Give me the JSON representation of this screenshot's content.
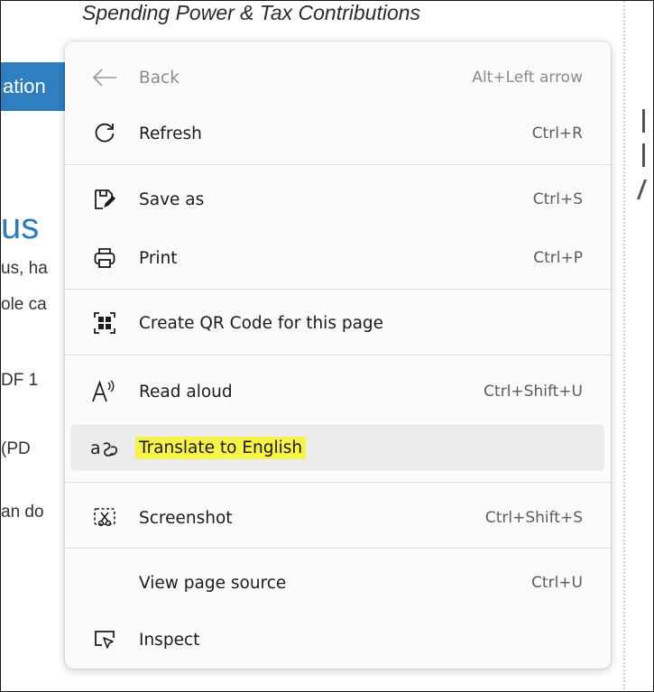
{
  "background": {
    "heading": "Spending Power & Tax Contributions",
    "tab_fragment": "ation",
    "big_fragment": "us",
    "text_lines": [
      "us, ha",
      "ole ca",
      "DF 1",
      "(PD",
      "an do"
    ]
  },
  "menu": {
    "items": [
      {
        "label": "Back",
        "shortcut": "Alt+Left arrow",
        "icon": "back-arrow-icon",
        "disabled": true
      },
      {
        "label": "Refresh",
        "shortcut": "Ctrl+R",
        "icon": "refresh-icon"
      },
      {
        "label": "Save as",
        "shortcut": "Ctrl+S",
        "icon": "save-as-icon"
      },
      {
        "label": "Print",
        "shortcut": "Ctrl+P",
        "icon": "print-icon"
      },
      {
        "label": "Create QR Code for this page",
        "shortcut": "",
        "icon": "qr-code-icon"
      },
      {
        "label": "Read aloud",
        "shortcut": "Ctrl+Shift+U",
        "icon": "read-aloud-icon"
      },
      {
        "label": "Translate to English",
        "shortcut": "",
        "icon": "translate-icon",
        "highlighted": true
      },
      {
        "label": "Screenshot",
        "shortcut": "Ctrl+Shift+S",
        "icon": "screenshot-icon"
      },
      {
        "label": "View page source",
        "shortcut": "Ctrl+U",
        "icon": ""
      },
      {
        "label": "Inspect",
        "shortcut": "",
        "icon": "inspect-icon"
      }
    ]
  },
  "colors": {
    "highlight": "#f6f34b",
    "tab_blue": "#2f7ec0",
    "heading_blue": "#2d79bd"
  }
}
